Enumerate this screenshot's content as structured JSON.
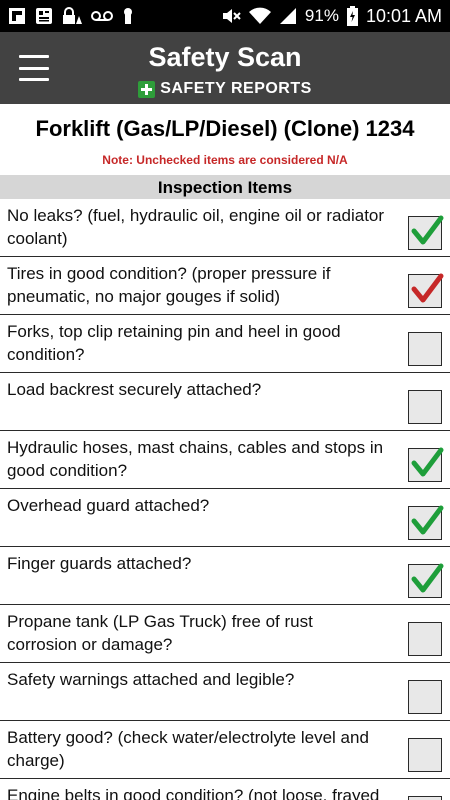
{
  "status_bar": {
    "battery_percent": "91%",
    "time": "10:01 AM",
    "left_icons": [
      "flipboard-icon",
      "news-icon",
      "lock-warning-icon",
      "voicemail-icon",
      "keyhole-icon"
    ],
    "right_icons": [
      "mute-icon",
      "wifi-icon",
      "signal-icon",
      "battery-icon"
    ]
  },
  "app_bar": {
    "title": "Safety Scan",
    "brand": "SAFETY REPORTS",
    "brand_color": "#2e9d3a",
    "background": "#424242"
  },
  "form": {
    "title": "Forklift (Gas/LP/Diesel) (Clone) 1234",
    "note": "Note: Unchecked items are considered N/A",
    "note_color": "#c62828",
    "section_header": "Inspection Items"
  },
  "items": [
    {
      "label": "No leaks? (fuel, hydraulic oil, engine oil or radiator coolant)",
      "checked": true,
      "check_color": "#1e9e3a"
    },
    {
      "label": "Tires in good condition? (proper pressure if pneumatic, no major gouges if solid)",
      "checked": true,
      "check_color": "#c62828"
    },
    {
      "label": "Forks, top clip retaining pin and heel in good condition?",
      "checked": false,
      "check_color": "#1e9e3a"
    },
    {
      "label": "Load backrest securely attached?",
      "checked": false,
      "check_color": "#1e9e3a"
    },
    {
      "label": "Hydraulic hoses, mast chains, cables and stops in good condition?",
      "checked": true,
      "check_color": "#1e9e3a"
    },
    {
      "label": "Overhead guard attached?",
      "checked": true,
      "check_color": "#1e9e3a"
    },
    {
      "label": "Finger guards attached?",
      "checked": true,
      "check_color": "#1e9e3a"
    },
    {
      "label": "Propane tank (LP Gas Truck) free of rust corrosion or damage?",
      "checked": false,
      "check_color": "#1e9e3a"
    },
    {
      "label": "Safety warnings attached and legible?",
      "checked": false,
      "check_color": "#1e9e3a"
    },
    {
      "label": "Battery good? (check water/electrolyte level and charge)",
      "checked": false,
      "check_color": "#1e9e3a"
    },
    {
      "label": "Engine belts in good condition? (not loose, frayed or cracked)",
      "checked": false,
      "check_color": "#1e9e3a"
    }
  ]
}
